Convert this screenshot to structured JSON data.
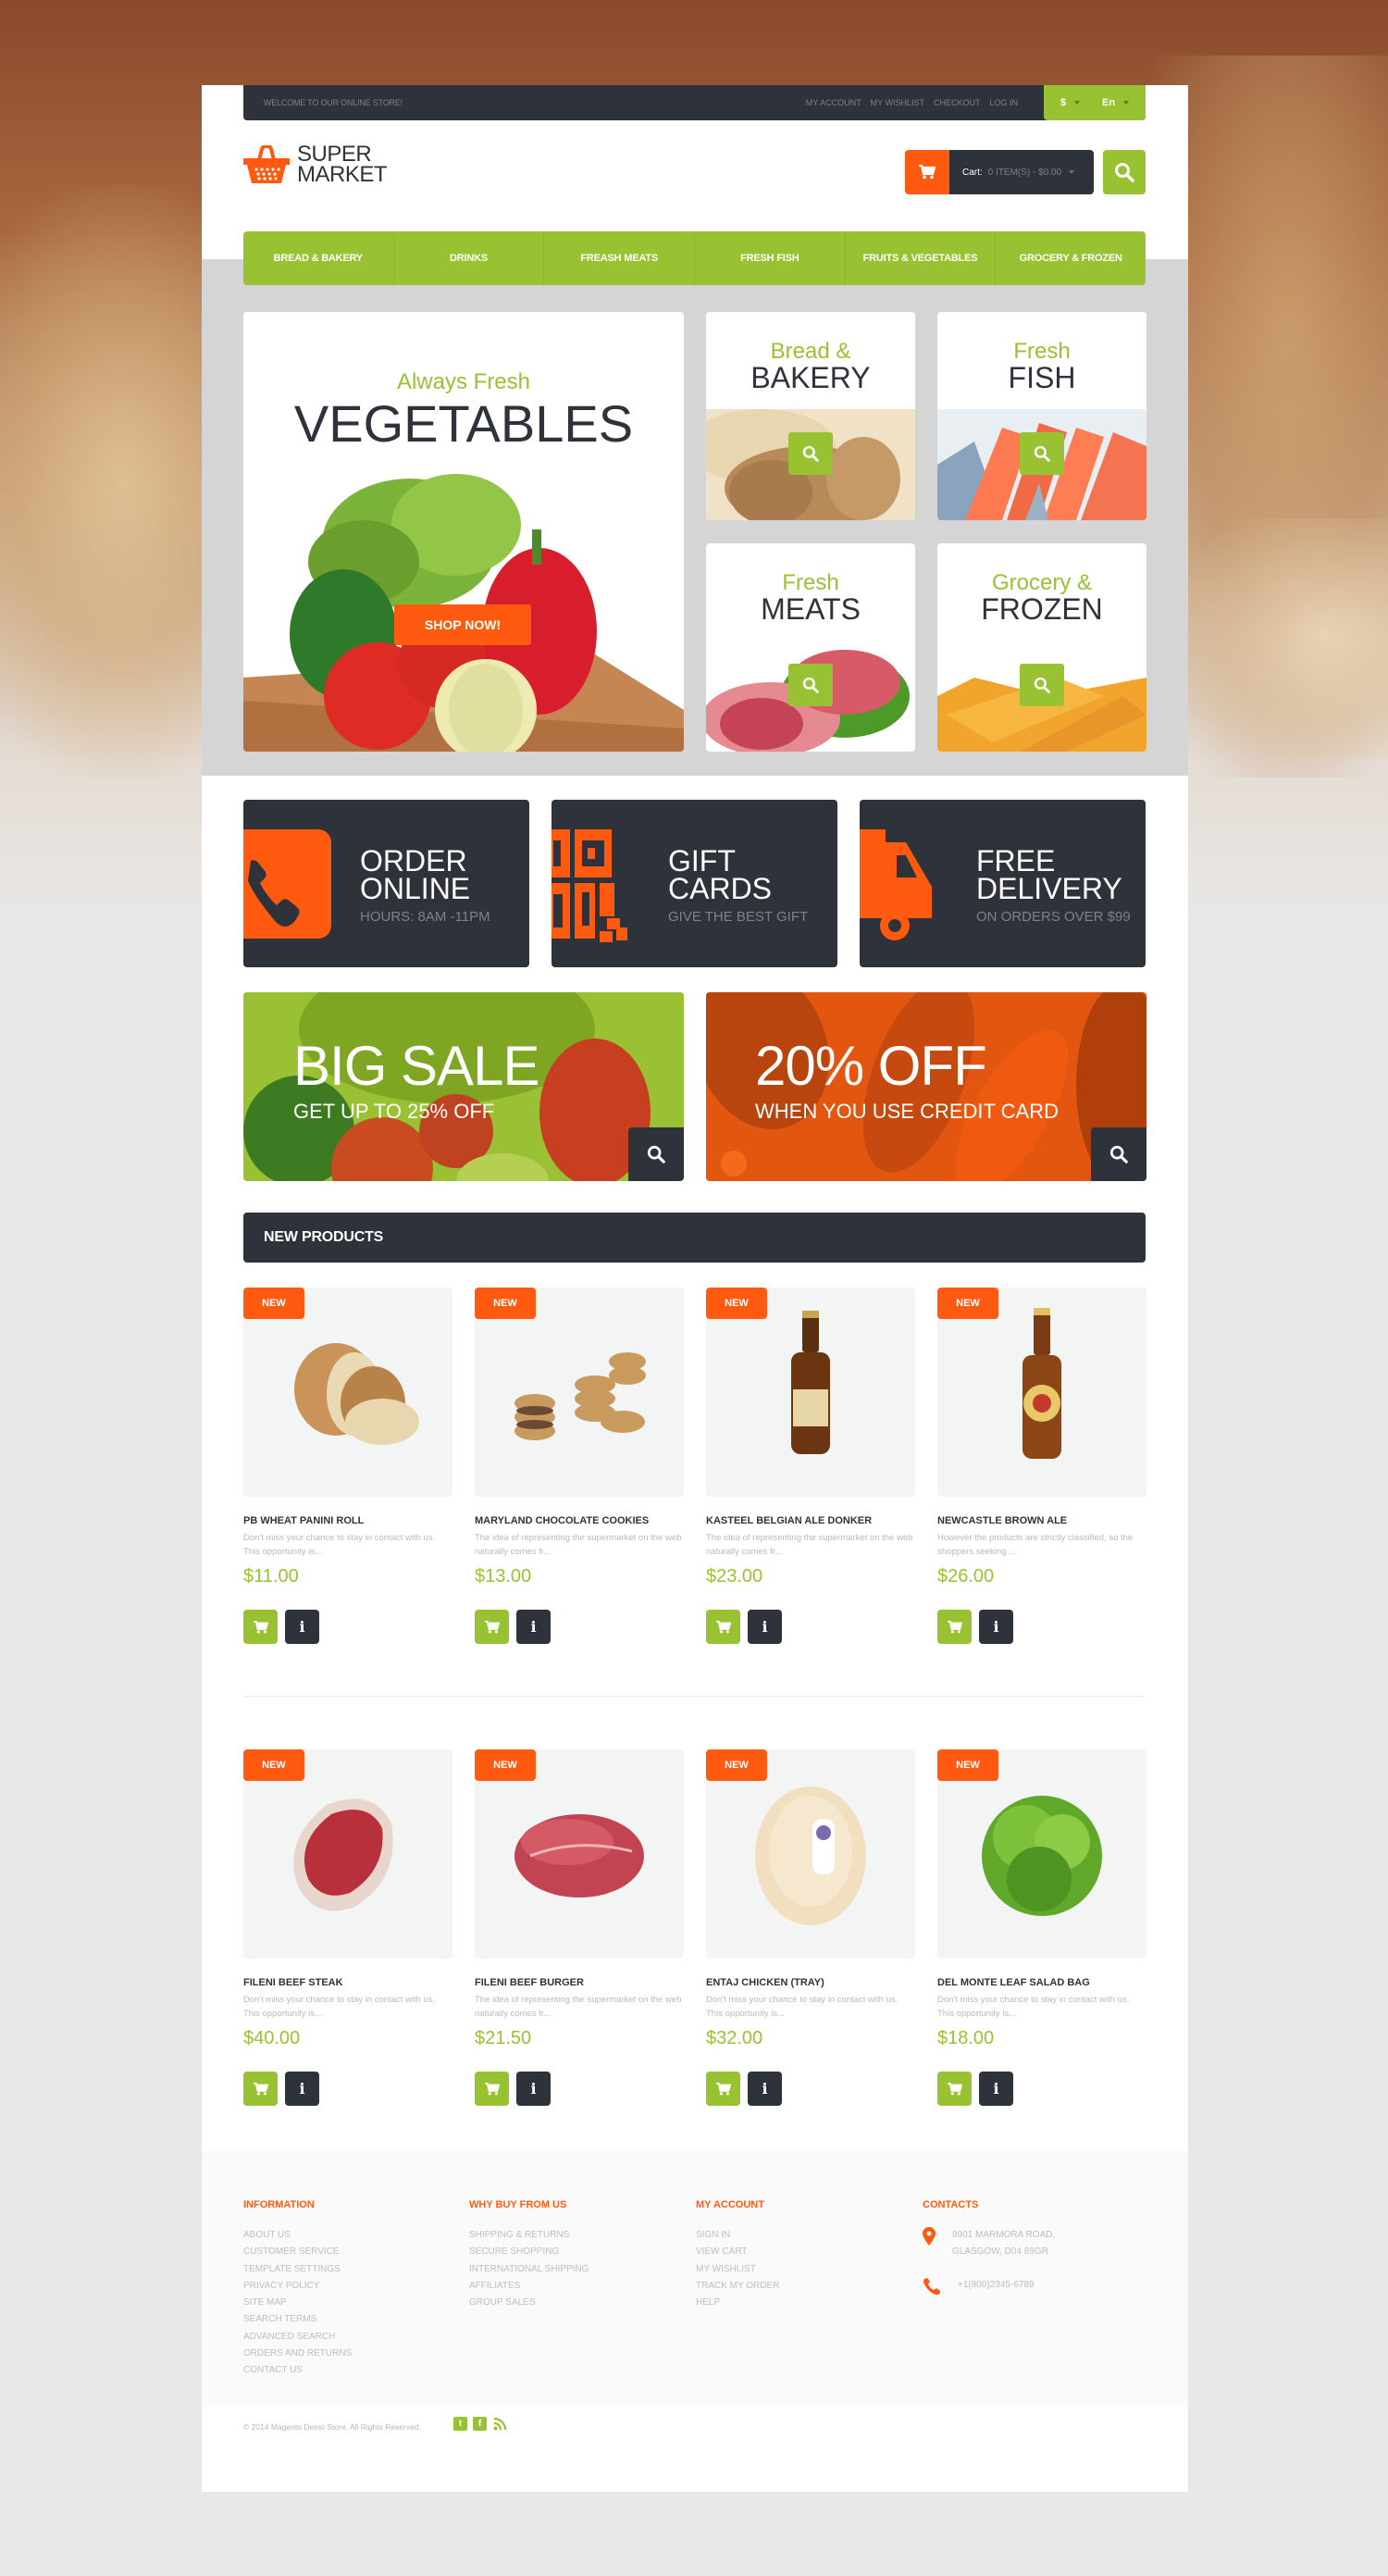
{
  "topbar": {
    "welcome": "WELCOME TO OUR ONLINE STORE!",
    "links": [
      "MY ACCOUNT",
      "MY WISHLIST",
      "CHECKOUT",
      "LOG IN"
    ],
    "currency": "$",
    "language": "En"
  },
  "header": {
    "logo_line1": "SUPER",
    "logo_line2": "MARKET",
    "cart_label": "Cart:",
    "cart_summary": "0 ITEM(S) - $0.00"
  },
  "nav": {
    "items": [
      "BREAD & BAKERY",
      "DRINKS",
      "FREASH MEATS",
      "FRESH FISH",
      "FRUITS & VEGETABLES",
      "GROCERY & FROZEN"
    ]
  },
  "hero": {
    "subtitle": "Always Fresh",
    "title": "VEGETABLES",
    "button": "SHOP NOW!"
  },
  "categories": [
    {
      "line1": "Bread &",
      "line2": "BAKERY"
    },
    {
      "line1": "Fresh",
      "line2": "FISH"
    },
    {
      "line1": "Fresh",
      "line2": "MEATS"
    },
    {
      "line1": "Grocery &",
      "line2": "FROZEN"
    }
  ],
  "features": [
    {
      "title1": "ORDER",
      "title2": "ONLINE",
      "subtitle": "HOURS: 8AM -11PM",
      "icon": "phone-icon"
    },
    {
      "title1": "GIFT",
      "title2": "CARDS",
      "subtitle": "GIVE THE BEST GIFT",
      "icon": "qr-code-icon"
    },
    {
      "title1": "FREE",
      "title2": "DELIVERY",
      "subtitle": "ON ORDERS OVER $99",
      "icon": "truck-icon"
    }
  ],
  "promos": [
    {
      "title": "BIG SALE",
      "subtitle": "GET UP TO 25% OFF"
    },
    {
      "title": "20% OFF",
      "subtitle": "WHEN YOU USE CREDIT CARD"
    }
  ],
  "new_products": {
    "title": "NEW PRODUCTS",
    "badge": "NEW",
    "items": [
      {
        "name": "PB WHEAT PANINI ROLL",
        "desc": "Don't miss your chance to stay in contact with us. This opportunity is...",
        "price": "$11.00",
        "image": "bread"
      },
      {
        "name": "MARYLAND CHOCOLATE COOKIES",
        "desc": "The idea of representing the supermarket on the web naturally comes fr...",
        "price": "$13.00",
        "image": "cookies"
      },
      {
        "name": "KASTEEL BELGIAN ALE DONKER",
        "desc": "The idea of representing the supermarket on the web naturally comes fr...",
        "price": "$23.00",
        "image": "beer-bottle"
      },
      {
        "name": "NEWCASTLE BROWN ALE",
        "desc": "However the products are strictly classified, so the shoppers seeking ...",
        "price": "$26.00",
        "image": "ale-bottle"
      },
      {
        "name": "FILENI BEEF STEAK",
        "desc": "Don't miss your chance to stay in contact with us. This opportunity is...",
        "price": "$40.00",
        "image": "steak"
      },
      {
        "name": "FILENI BEEF BURGER",
        "desc": "The idea of representing the supermarket on the web naturally comes fr...",
        "price": "$21.50",
        "image": "beef"
      },
      {
        "name": "ENTAJ CHICKEN (TRAY)",
        "desc": "Don't miss your chance to stay in contact with us. This opportunity is...",
        "price": "$32.00",
        "image": "chicken"
      },
      {
        "name": "DEL MONTE LEAF SALAD BAG",
        "desc": "Don't miss your chance to stay in contact with us. This opportunity is...",
        "price": "$18.00",
        "image": "lettuce"
      }
    ]
  },
  "footer": {
    "columns": [
      {
        "title": "INFORMATION",
        "links": [
          "ABOUT US",
          "CUSTOMER SERVICE",
          "TEMPLATE SETTINGS",
          "PRIVACY POLICY",
          "SITE MAP",
          "SEARCH TERMS",
          "ADVANCED SEARCH",
          "ORDERS AND RETURNS",
          "CONTACT US"
        ]
      },
      {
        "title": "WHY BUY FROM US",
        "links": [
          "SHIPPING & RETURNS",
          "SECURE SHOPPING",
          "INTERNATIONAL SHIPPING",
          "AFFILIATES",
          "GROUP SALES"
        ]
      },
      {
        "title": "MY ACCOUNT",
        "links": [
          "SIGN IN",
          "VIEW CART",
          "MY WISHLIST",
          "TRACK MY ORDER",
          "HELP"
        ]
      }
    ],
    "contacts": {
      "title": "CONTACTS",
      "address_line1": "8901 MARMORA ROAD,",
      "address_line2": "GLASGOW, D04 89GR",
      "phone": "+1(800)2345-6789"
    },
    "copyright": "© 2014 Magento Demo Store. All Rights Reserved."
  },
  "colors": {
    "accent_green": "#98c232",
    "accent_orange": "#ff5a0f",
    "dark": "#2e323b"
  }
}
